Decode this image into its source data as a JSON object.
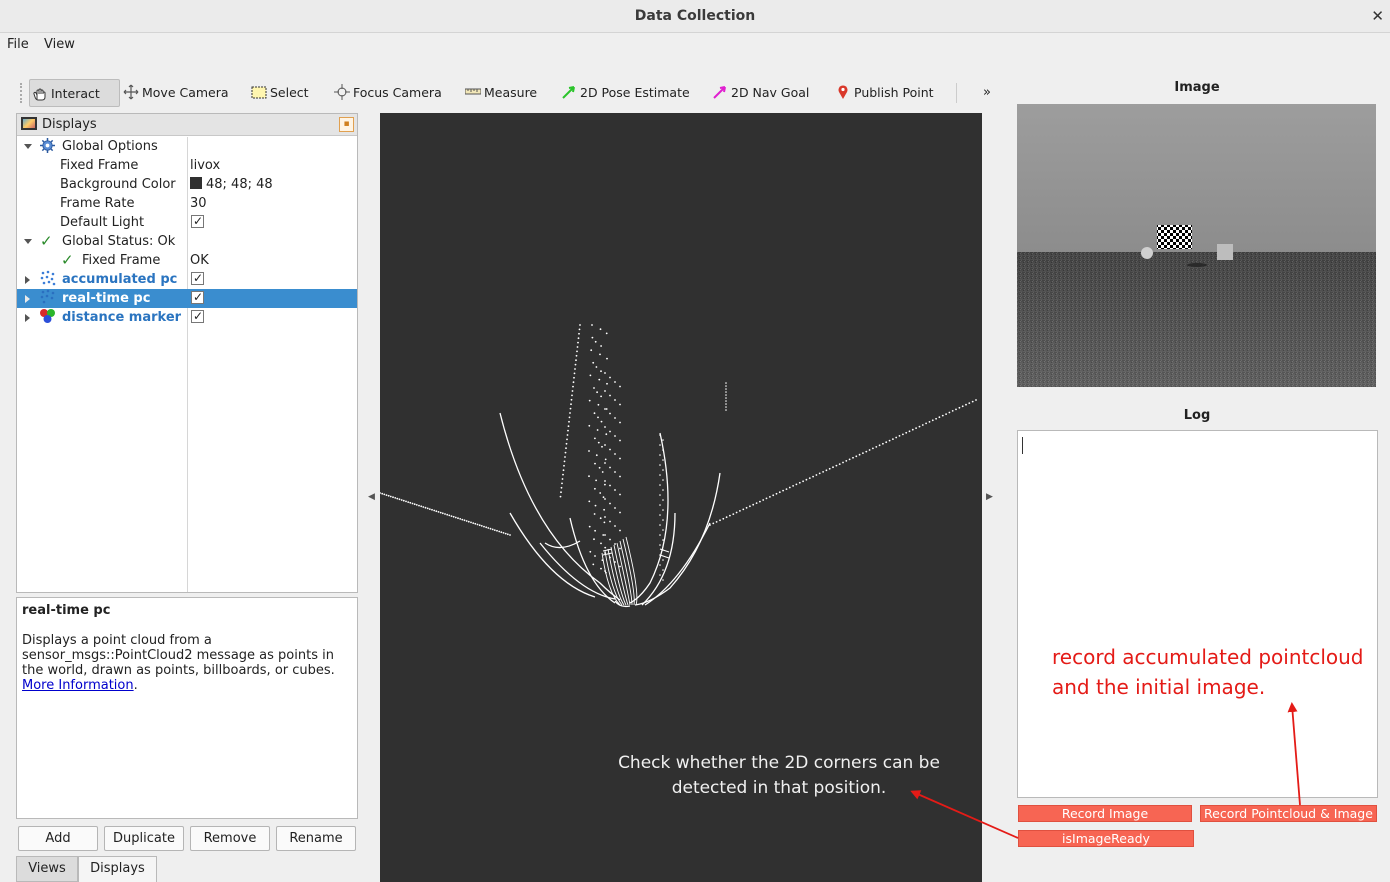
{
  "window": {
    "title": "Data Collection",
    "close_glyph": "✕"
  },
  "menu": {
    "file": "File",
    "view": "View"
  },
  "toolbar": {
    "interact": "Interact",
    "move_camera": "Move Camera",
    "select": "Select",
    "focus_camera": "Focus Camera",
    "measure": "Measure",
    "pose_estimate": "2D Pose Estimate",
    "nav_goal": "2D Nav Goal",
    "publish_point": "Publish Point",
    "more": "»"
  },
  "displays": {
    "title": "Displays",
    "rows": [
      {
        "label": "Global Options",
        "value": ""
      },
      {
        "label": "Fixed Frame",
        "value": "livox"
      },
      {
        "label": "Background Color",
        "value": "48; 48; 48"
      },
      {
        "label": "Frame Rate",
        "value": "30"
      },
      {
        "label": "Default Light",
        "value": ""
      },
      {
        "label": "Global Status: Ok",
        "value": ""
      },
      {
        "label": "Fixed Frame",
        "value": "OK"
      },
      {
        "label": "accumulated pc",
        "value": ""
      },
      {
        "label": "real-time pc",
        "value": ""
      },
      {
        "label": "distance marker",
        "value": ""
      }
    ],
    "bg_color": "#303030"
  },
  "description": {
    "title": "real-time pc",
    "body": "Displays a point cloud from a sensor_msgs::PointCloud2 message as points in the world, drawn as points, billboards, or cubes.",
    "link": "More Information",
    "after_link": "."
  },
  "buttons": {
    "add": "Add",
    "duplicate": "Duplicate",
    "remove": "Remove",
    "rename": "Rename"
  },
  "tabs": {
    "views": "Views",
    "displays": "Displays"
  },
  "right": {
    "image_title": "Image",
    "log_title": "Log",
    "record_image": "Record Image",
    "record_pc_image": "Record Pointcloud & Image",
    "is_image_ready": "isImageReady"
  },
  "annotations": {
    "record_note": "record accumulated pointcloud and the initial image.",
    "corner_note": "Check whether the 2D corners can be detected in that position."
  },
  "colors": {
    "selection": "#3a8dcf",
    "record_button": "#f76553",
    "annotation_red": "#e41b17"
  }
}
